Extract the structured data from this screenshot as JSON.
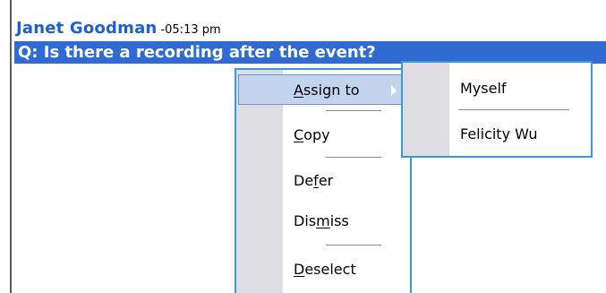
{
  "message": {
    "sender": "Janet Goodman",
    "time": "-05:13 pm",
    "question": "Q: Is there a recording after the event?"
  },
  "context_menu": {
    "items": [
      {
        "label_pre": "",
        "label_mnemonic": "A",
        "label_post": "ssign to",
        "has_submenu": true,
        "active": true
      },
      {
        "label_pre": "",
        "label_mnemonic": "C",
        "label_post": "opy"
      },
      {
        "label_pre": "De",
        "label_mnemonic": "f",
        "label_post": "er"
      },
      {
        "label_pre": "Dis",
        "label_mnemonic": "m",
        "label_post": "iss"
      },
      {
        "label_pre": "",
        "label_mnemonic": "D",
        "label_post": "eselect"
      }
    ]
  },
  "assign_submenu": {
    "items": [
      {
        "label": "Myself"
      },
      {
        "label": "Felicity Wu"
      }
    ]
  },
  "colors": {
    "sender_text": "#1f5fd0",
    "selection_bar": "#2f6bd2",
    "menu_border": "#3a9ad9",
    "menu_gutter": "#dedee2",
    "active_item": "#c3d4ef"
  }
}
